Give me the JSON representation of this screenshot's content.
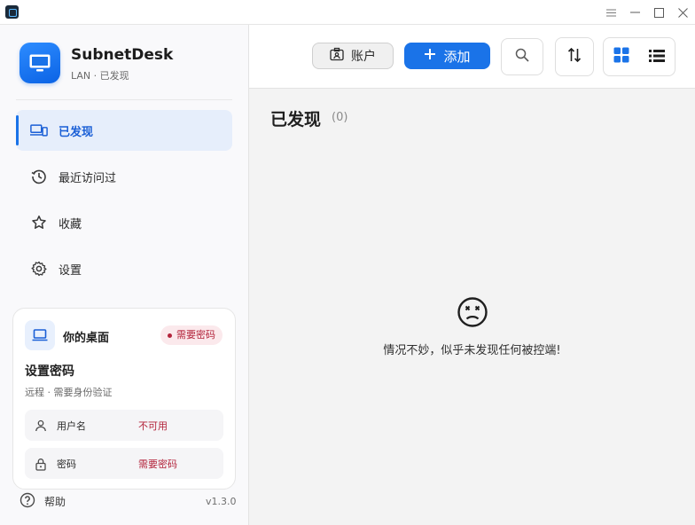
{
  "window": {
    "controls": [
      "menu",
      "minimize",
      "maximize",
      "close"
    ]
  },
  "brand": {
    "name": "SubnetDesk",
    "subtitle": "LAN · 已发现",
    "accent": "#1a73e8"
  },
  "sidebar": {
    "items": [
      {
        "label": "已发现",
        "icon": "devices-icon",
        "active": true
      },
      {
        "label": "最近访问过",
        "icon": "history-icon",
        "active": false
      },
      {
        "label": "收藏",
        "icon": "star-icon",
        "active": false
      },
      {
        "label": "设置",
        "icon": "gear-icon",
        "active": false
      }
    ]
  },
  "desktop_card": {
    "title": "你的桌面",
    "badge": "需要密码",
    "heading": "设置密码",
    "subtitle": "远程 · 需要身份验证",
    "rows": [
      {
        "label": "用户名",
        "value": "不可用",
        "icon": "person-icon"
      },
      {
        "label": "密码",
        "value": "需要密码",
        "icon": "lock-icon"
      }
    ]
  },
  "footer": {
    "help_label": "帮助",
    "version": "v1.3.0"
  },
  "toolbar": {
    "account_label": "账户",
    "add_label": "添加",
    "search_icon": "search-icon",
    "sort_icon": "sort-icon",
    "view_grid_icon": "grid-view-icon",
    "view_list_icon": "list-view-icon"
  },
  "main": {
    "title": "已发现",
    "count": "(0)",
    "empty_message": "情况不妙，似乎未发现任何被控端!",
    "empty_icon": "sad-face-icon"
  }
}
